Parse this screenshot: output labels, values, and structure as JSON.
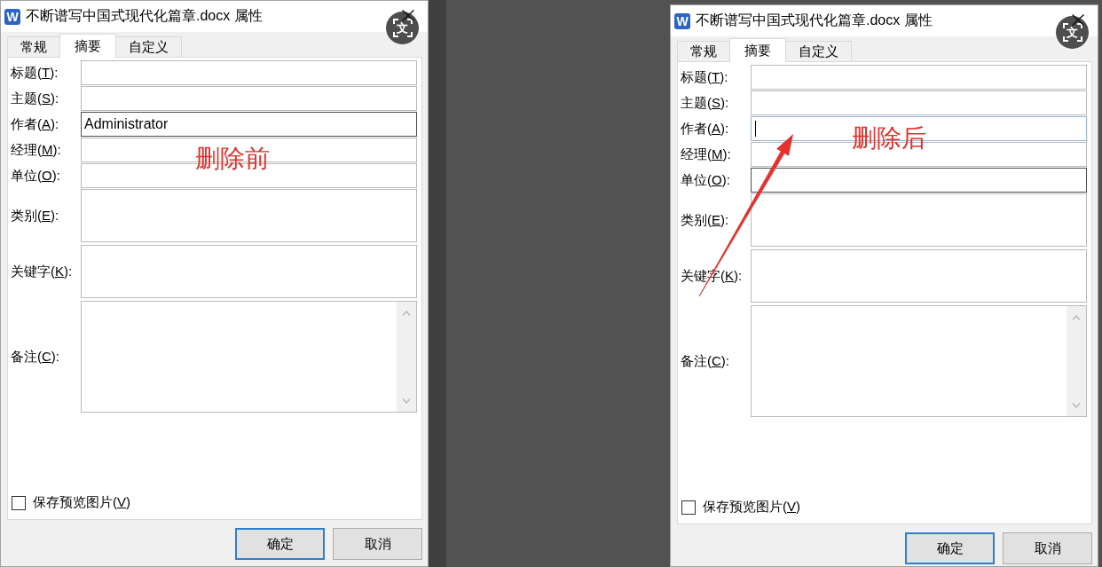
{
  "dialogs": [
    {
      "app_icon": "W",
      "title": "不断谱写中国式现代化篇章.docx 属性",
      "translate_glyph": "文",
      "tabs": [
        {
          "label": "常规",
          "selected": false
        },
        {
          "label": "摘要",
          "selected": true
        },
        {
          "label": "自定义",
          "selected": false
        }
      ],
      "fields": [
        {
          "kind": "line",
          "label_start": "标题(",
          "access_key": "T",
          "label_end": "):",
          "focused": false,
          "hovered": false
        },
        {
          "kind": "line",
          "label_start": "主题(",
          "access_key": "S",
          "label_end": "):",
          "focused": false,
          "hovered": false
        },
        {
          "kind": "line",
          "label_start": "作者(",
          "access_key": "A",
          "label_end": "):",
          "value": "Administrator",
          "focused": false,
          "hovered": true
        },
        {
          "kind": "line",
          "label_start": "经理(",
          "access_key": "M",
          "label_end": "):",
          "focused": false,
          "hovered": false
        },
        {
          "kind": "line",
          "label_start": "单位(",
          "access_key": "O",
          "label_end": "):",
          "focused": false,
          "hovered": false
        },
        {
          "kind": "multiline",
          "label_start": "类别(",
          "access_key": "E",
          "label_end": "):",
          "focused": false,
          "hovered": false
        },
        {
          "kind": "multiline",
          "label_start": "关键字(",
          "access_key": "K",
          "label_end": "):",
          "focused": false,
          "hovered": false
        },
        {
          "kind": "memo",
          "label_start": "备注(",
          "access_key": "C",
          "label_end": "):",
          "focused": false,
          "hovered": false
        }
      ],
      "preview_checkbox": {
        "label_start": "保存预览图片(",
        "access_key": "V",
        "label_end": ")",
        "checked": false
      },
      "buttons": [
        {
          "label": "确定",
          "default": true
        },
        {
          "label": "取消",
          "default": false
        }
      ],
      "annotation": {
        "text": "删除前",
        "arrow": false
      }
    },
    {
      "app_icon": "W",
      "title": "不断谱写中国式现代化篇章.docx 属性",
      "translate_glyph": "文",
      "tabs": [
        {
          "label": "常规",
          "selected": false
        },
        {
          "label": "摘要",
          "selected": true
        },
        {
          "label": "自定义",
          "selected": false
        }
      ],
      "fields": [
        {
          "kind": "line",
          "label_start": "标题(",
          "access_key": "T",
          "label_end": "):",
          "focused": false,
          "hovered": false
        },
        {
          "kind": "line",
          "label_start": "主题(",
          "access_key": "S",
          "label_end": "):",
          "focused": false,
          "hovered": false
        },
        {
          "kind": "line",
          "label_start": "作者(",
          "access_key": "A",
          "label_end": "):",
          "focused": true,
          "hovered": false
        },
        {
          "kind": "line",
          "label_start": "经理(",
          "access_key": "M",
          "label_end": "):",
          "focused": false,
          "hovered": false
        },
        {
          "kind": "line",
          "label_start": "单位(",
          "access_key": "O",
          "label_end": "):",
          "focused": false,
          "hovered": true
        },
        {
          "kind": "multiline",
          "label_start": "类别(",
          "access_key": "E",
          "label_end": "):",
          "focused": false,
          "hovered": false
        },
        {
          "kind": "multiline",
          "label_start": "关键字(",
          "access_key": "K",
          "label_end": "):",
          "focused": false,
          "hovered": false
        },
        {
          "kind": "memo",
          "label_start": "备注(",
          "access_key": "C",
          "label_end": "):",
          "focused": false,
          "hovered": false
        }
      ],
      "preview_checkbox": {
        "label_start": "保存预览图片(",
        "access_key": "V",
        "label_end": ")",
        "checked": false
      },
      "buttons": [
        {
          "label": "确定",
          "default": true
        },
        {
          "label": "取消",
          "default": false
        }
      ],
      "annotation": {
        "text": "删除后",
        "arrow": true
      }
    }
  ]
}
